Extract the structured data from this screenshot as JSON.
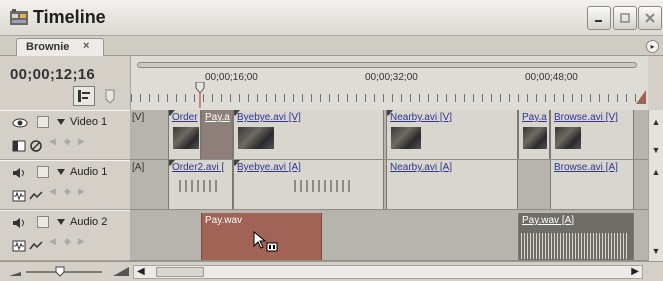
{
  "window": {
    "title": "Timeline",
    "icon": "timeline-app-icon"
  },
  "window_controls": {
    "minimize": "minimize-icon",
    "maximize": "maximize-icon",
    "close": "close-icon"
  },
  "tab": {
    "label": "Brownie",
    "close": "×"
  },
  "panel_menu": {
    "glyph": "▸"
  },
  "timecode": "00;00;12;16",
  "ruler": {
    "ticks": [
      "00;00;16;00",
      "00;00;32;00",
      "00;00;48;00"
    ]
  },
  "tracks": {
    "video1": {
      "name": "Video 1",
      "track_label": "[V]",
      "clips": [
        {
          "label": "Order"
        },
        {
          "label": "Pay.a"
        },
        {
          "label": "Byebye.avi [V]"
        },
        {
          "label": "Nearby.avi [V]"
        },
        {
          "label": "Pay.a"
        },
        {
          "label": "Browse.avi [V]"
        }
      ]
    },
    "audio1": {
      "name": "Audio 1",
      "track_label": "[A]",
      "clips": [
        {
          "label": "Order2.avi ["
        },
        {
          "label": "Byebye.avi [A]"
        },
        {
          "label": "Nearby.avi [A]"
        },
        {
          "label": "Browse.avi [A]"
        }
      ]
    },
    "audio2": {
      "name": "Audio 2",
      "clips": [
        {
          "label": "Pay.wav"
        },
        {
          "label": "Pay.wav [A]"
        }
      ]
    }
  },
  "colors": {
    "panel": "#d4d0c8",
    "lane": "#b7b4ad",
    "clip": "#d9d6cf",
    "selected_audio": "#a06356",
    "link": "#2f3590"
  }
}
